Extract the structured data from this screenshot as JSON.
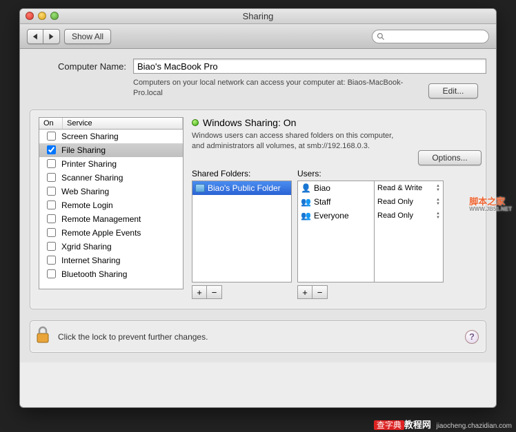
{
  "window": {
    "title": "Sharing"
  },
  "toolbar": {
    "show_all": "Show All",
    "search_placeholder": ""
  },
  "name_row": {
    "label": "Computer Name:",
    "value": "Biao's MacBook Pro",
    "hint": "Computers on your local network can access your computer at: Biaos-MacBook-Pro.local",
    "edit": "Edit..."
  },
  "services": {
    "header_on": "On",
    "header_service": "Service",
    "items": [
      {
        "label": "Screen Sharing",
        "on": false,
        "selected": false
      },
      {
        "label": "File Sharing",
        "on": true,
        "selected": true
      },
      {
        "label": "Printer Sharing",
        "on": false,
        "selected": false
      },
      {
        "label": "Scanner Sharing",
        "on": false,
        "selected": false
      },
      {
        "label": "Web Sharing",
        "on": false,
        "selected": false
      },
      {
        "label": "Remote Login",
        "on": false,
        "selected": false
      },
      {
        "label": "Remote Management",
        "on": false,
        "selected": false
      },
      {
        "label": "Remote Apple Events",
        "on": false,
        "selected": false
      },
      {
        "label": "Xgrid Sharing",
        "on": false,
        "selected": false
      },
      {
        "label": "Internet Sharing",
        "on": false,
        "selected": false
      },
      {
        "label": "Bluetooth Sharing",
        "on": false,
        "selected": false
      }
    ]
  },
  "detail": {
    "status_label": "Windows Sharing: On",
    "description": "Windows users can access shared folders on this computer, and administrators all volumes, at smb://192.168.0.3.",
    "options": "Options...",
    "folders_label": "Shared Folders:",
    "users_label": "Users:",
    "folders": [
      {
        "name": "Biao's Public Folder",
        "selected": true
      }
    ],
    "users": [
      {
        "name": "Biao",
        "perm": "Read & Write",
        "icon": "single"
      },
      {
        "name": "Staff",
        "perm": "Read Only",
        "icon": "group"
      },
      {
        "name": "Everyone",
        "perm": "Read Only",
        "icon": "group"
      }
    ]
  },
  "lock": {
    "text": "Click the lock to prevent further changes."
  },
  "watermark": {
    "main": "脚本之家",
    "sub": "WWW.JB51.NET"
  },
  "footer": {
    "brand": "查字典",
    "suffix": "教程网",
    "url": "jiaocheng.chazidian.com"
  }
}
